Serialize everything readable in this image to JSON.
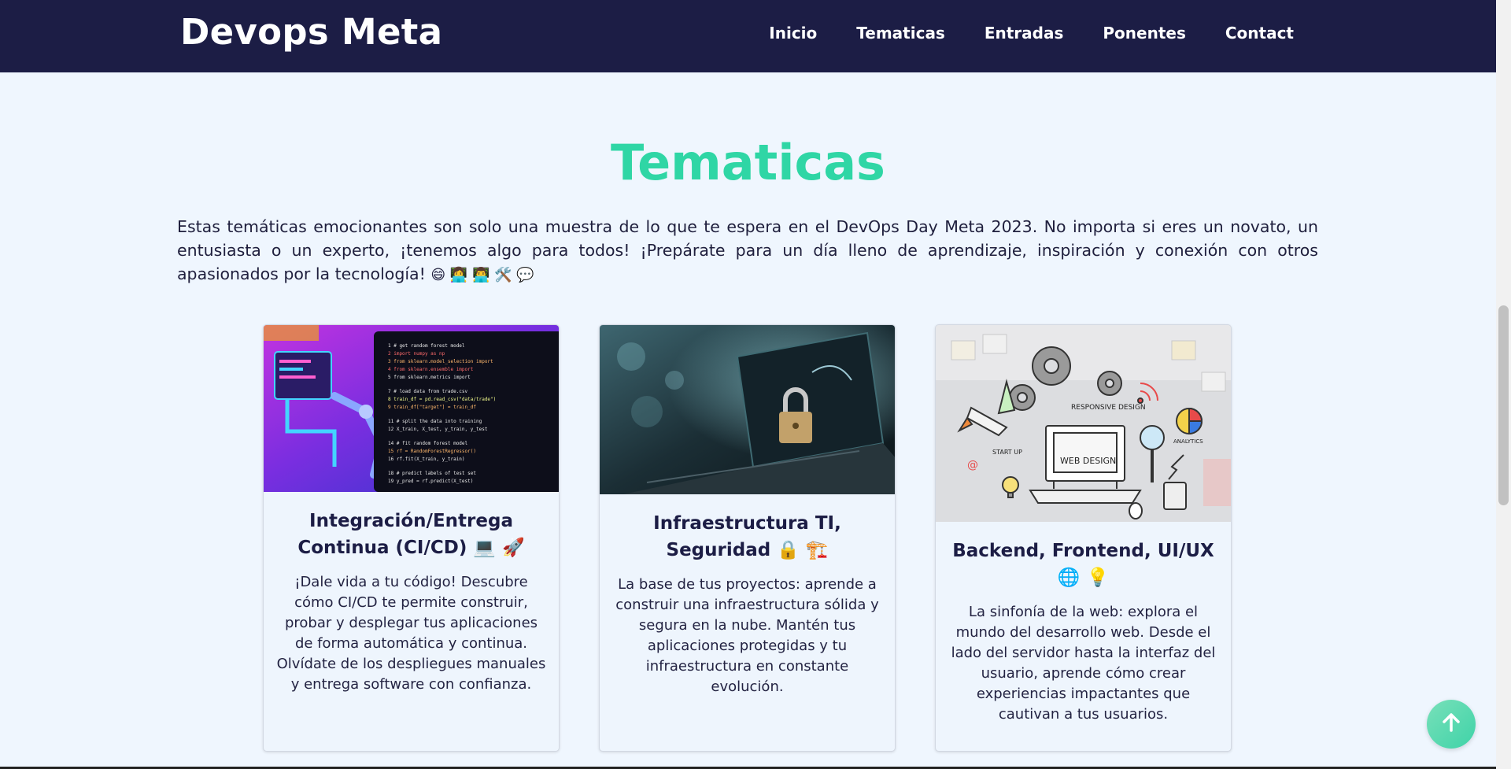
{
  "header": {
    "brand": "Devops Meta",
    "nav": [
      "Inicio",
      "Tematicas",
      "Entradas",
      "Ponentes",
      "Contact"
    ]
  },
  "section": {
    "title": "Tematicas",
    "intro": "Estas temáticas emocionantes son solo una muestra de lo que te espera en el DevOps Day Meta 2023. No importa si eres un novato, un entusiasta o un experto, ¡tenemos algo para todos! ¡Prepárate para un día lleno de aprendizaje, inspiración y conexión con otros apasionados por la tecnología!",
    "intro_emojis": "😄 👩‍💻 👨‍💻 🛠️ 💬"
  },
  "cards": [
    {
      "title": "Integración/Entrega Continua (CI/CD) 💻 🚀",
      "text": "¡Dale vida a tu código! Descubre cómo CI/CD te permite construir, probar y desplegar tus aplicaciones de forma automática y continua. Olvídate de los despliegues manuales y entrega software con confianza."
    },
    {
      "title": "Infraestructura TI, Seguridad 🔒 🏗️",
      "text": "La base de tus proyectos: aprende a construir una infraestructura sólida y segura en la nube. Mantén tus aplicaciones protegidas y tu infraestructura en constante evolución."
    },
    {
      "title": "Backend, Frontend, UI/UX 🌐 💡",
      "text": "La sinfonía de la web: explora el mundo del desarrollo web. Desde el lado del servidor hasta la interfaz del usuario, aprende cómo crear experiencias impactantes que cautivan a tus usuarios.",
      "image_labels": [
        "RESPONSIVE DESIGN",
        "START UP",
        "ANALYTICS",
        "WEB DESIGN"
      ]
    }
  ],
  "icons": {
    "to_top": "arrow-up-icon"
  },
  "colors": {
    "navbar": "#1c1d45",
    "accent": "#2fd6a5",
    "background": "#eff6fe"
  }
}
